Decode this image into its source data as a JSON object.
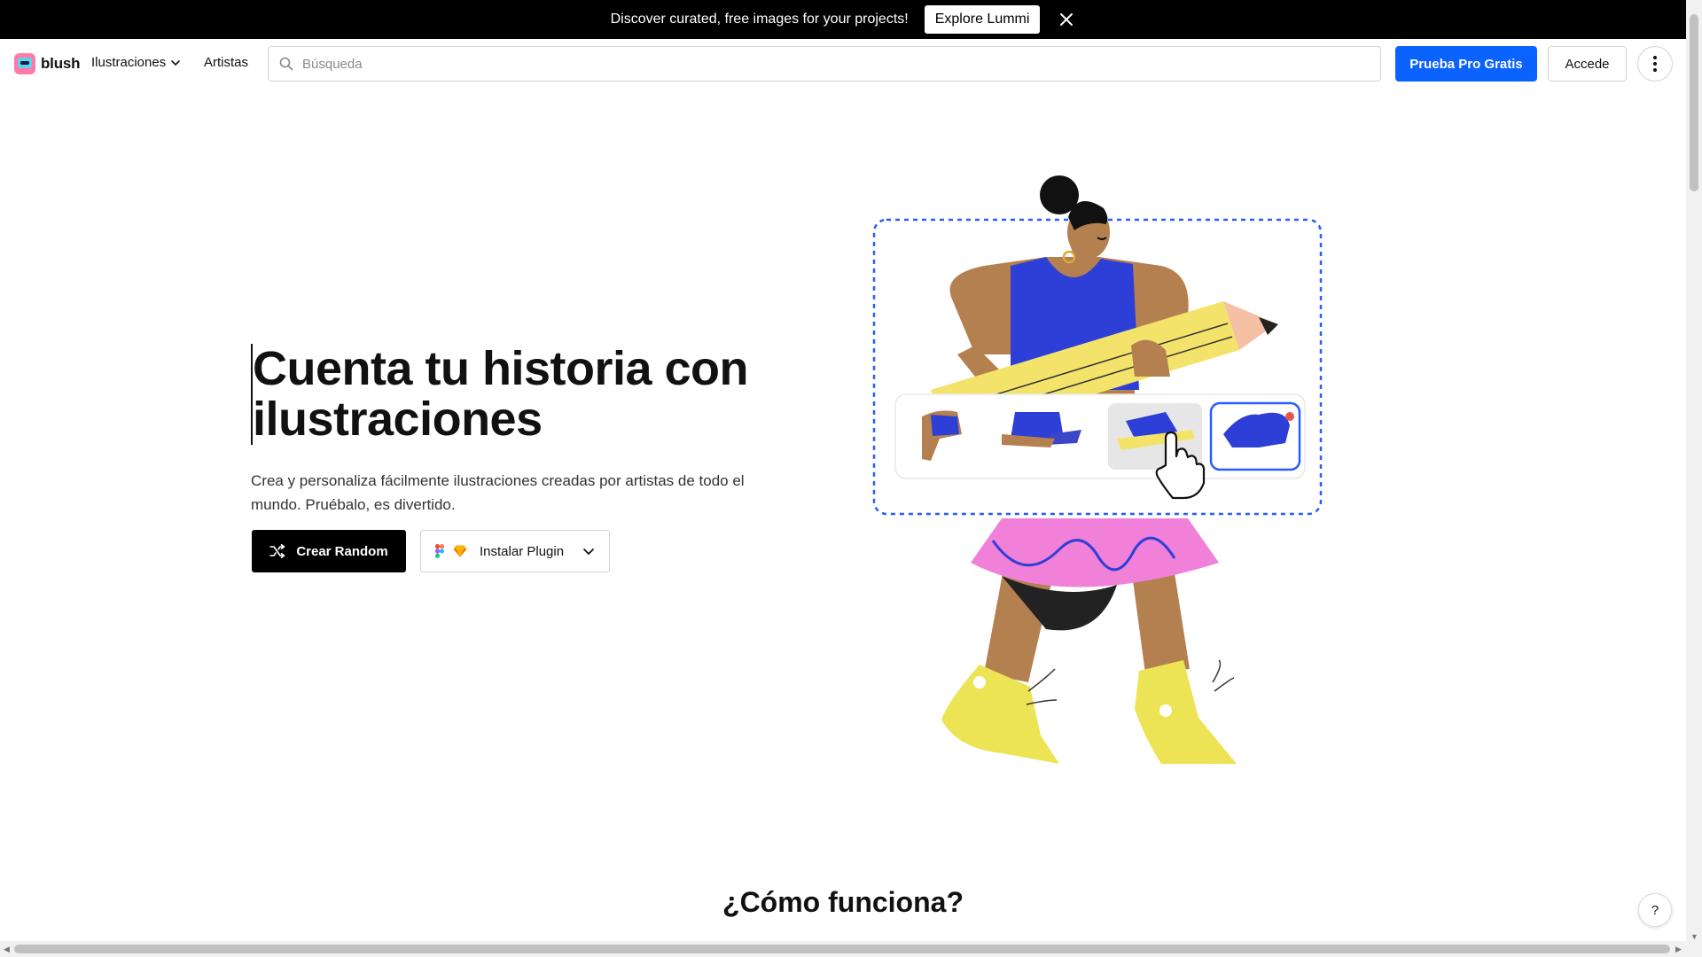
{
  "banner": {
    "text": "Discover curated, free images for your projects!",
    "button": "Explore Lummi"
  },
  "header": {
    "logo": "blush",
    "nav_illustrations": "Ilustraciones",
    "nav_artists": "Artistas",
    "search_placeholder": "Búsqueda",
    "pro_button": "Prueba Pro Gratis",
    "login_button": "Accede"
  },
  "hero": {
    "title": "Cuenta tu historia con ilustraciones",
    "subtitle": "Crea y personaliza fácilmente ilustraciones creadas por artistas de todo el mundo. Pruébalo, es divertido.",
    "random_button": "Crear Random",
    "plugin_button": "Instalar Plugin"
  },
  "section": {
    "title": "¿Cómo funciona?"
  },
  "help": "?",
  "colors": {
    "accent": "#0a62ff",
    "banner_bg": "#000000",
    "skin": "#b5804f",
    "shirt": "#2d3fd6",
    "skirt": "#f080d8",
    "pencil": "#f4e36a",
    "shoes": "#ece454"
  },
  "icons": [
    "close-icon",
    "chevron-down-icon",
    "search-icon",
    "more-vertical-icon",
    "shuffle-icon",
    "figma-icon",
    "sketch-icon",
    "hand-cursor-icon"
  ]
}
